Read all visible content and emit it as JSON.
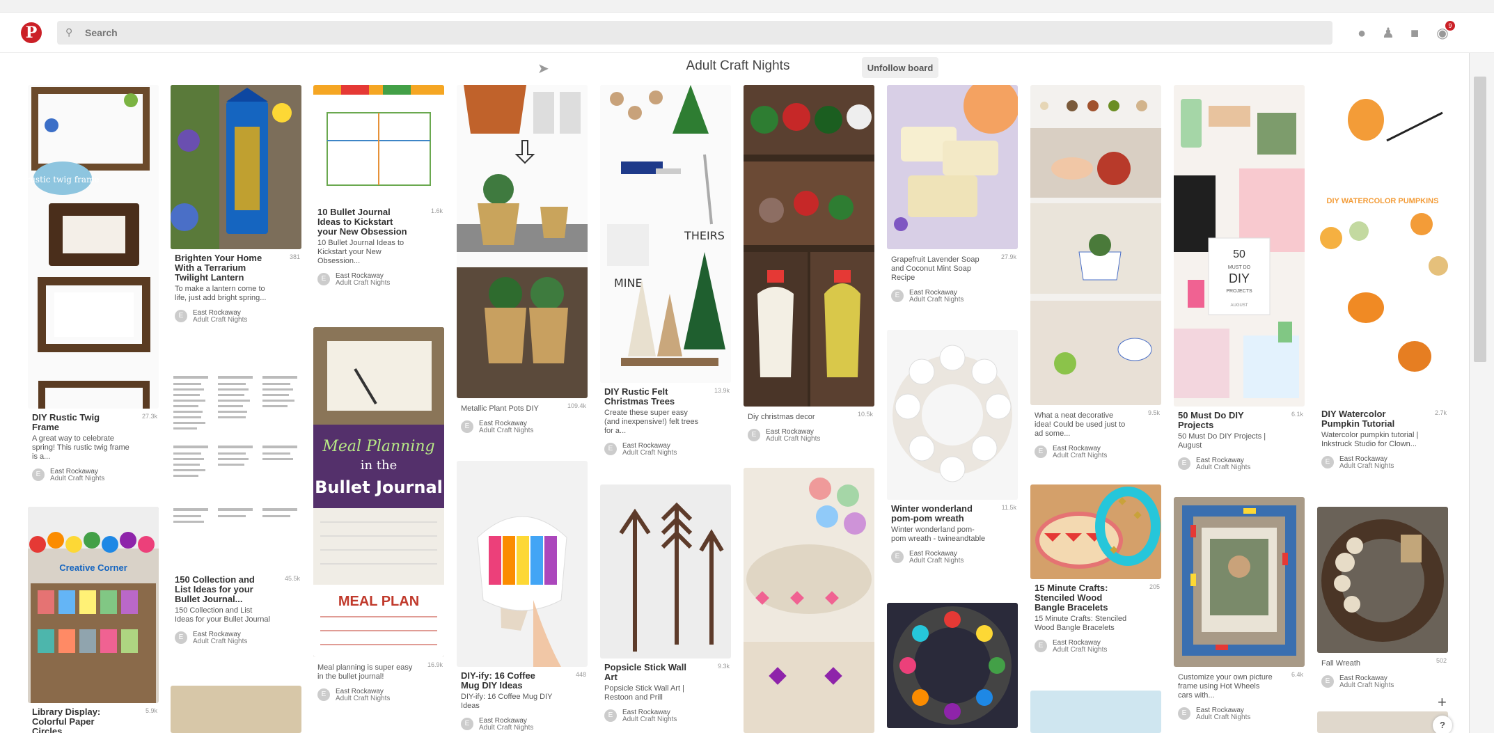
{
  "header": {
    "logo": "P",
    "search_placeholder": "Search",
    "notification_count": "9"
  },
  "board": {
    "title": "Adult Craft Nights",
    "unfollow_label": "Unfollow board"
  },
  "pins": [
    {
      "title": "DIY Rustic Twig Frame",
      "desc": "A great way to celebrate spring! This rustic twig frame is a...",
      "stat": "27.3k",
      "user": "East Rockaway",
      "board": "Adult Craft Nights"
    },
    {
      "title": "Library Display: Colorful Paper Circles",
      "desc": "",
      "stat": "5.9k",
      "user": "",
      "board": ""
    },
    {
      "title": "Brighten Your Home With a Terrarium Twilight Lantern",
      "desc": "To make a lantern come to life, just add bright spring...",
      "stat": "381",
      "user": "East Rockaway",
      "board": "Adult Craft Nights"
    },
    {
      "title": "150 Collection and List Ideas for your Bullet Journal...",
      "desc": "150 Collection and List Ideas for your Bullet Journal",
      "stat": "45.5k",
      "user": "East Rockaway",
      "board": "Adult Craft Nights"
    },
    {
      "title": "10 Bullet Journal Ideas to Kickstart your New Obsession",
      "desc": "10 Bullet Journal Ideas to Kickstart your New Obsession...",
      "stat": "1.6k",
      "user": "East Rockaway",
      "board": "Adult Craft Nights"
    },
    {
      "title": "",
      "desc": "Meal planning is super easy in the bullet journal!",
      "stat": "16.9k",
      "user": "East Rockaway",
      "board": "Adult Craft Nights"
    },
    {
      "title": "",
      "desc": "Metallic Plant Pots DIY",
      "stat": "109.4k",
      "user": "East Rockaway",
      "board": "Adult Craft Nights"
    },
    {
      "title": "DIY-ify: 16 Coffee Mug DIY Ideas",
      "desc": "DIY-ify: 16 Coffee Mug DIY Ideas",
      "stat": "448",
      "user": "East Rockaway",
      "board": "Adult Craft Nights"
    },
    {
      "title": "DIY Rustic Felt Christmas Trees",
      "desc": "Create these super easy (and inexpensive!) felt trees for a...",
      "stat": "13.9k",
      "user": "East Rockaway",
      "board": "Adult Craft Nights"
    },
    {
      "title": "Popsicle Stick Wall Art",
      "desc": "Popsicle Stick Wall Art | Restoon and Prill",
      "stat": "9.3k",
      "user": "East Rockaway",
      "board": "Adult Craft Nights"
    },
    {
      "title": "",
      "desc": "Diy christmas decor",
      "stat": "10.5k",
      "user": "East Rockaway",
      "board": "Adult Craft Nights"
    },
    {
      "title": "",
      "desc": "Grapefruit Lavender Soap and Coconut Mint Soap Recipe",
      "stat": "27.9k",
      "user": "East Rockaway",
      "board": "Adult Craft Nights"
    },
    {
      "title": "Winter wonderland pom-pom wreath",
      "desc": "Winter wonderland pom-pom wreath - twineandtable",
      "stat": "11.5k",
      "user": "East Rockaway",
      "board": "Adult Craft Nights"
    },
    {
      "title": "",
      "desc": "What a neat decorative idea! Could be used just to ad some...",
      "stat": "9.5k",
      "user": "East Rockaway",
      "board": "Adult Craft Nights"
    },
    {
      "title": "15 Minute Crafts: Stenciled Wood Bangle Bracelets",
      "desc": "15 Minute Crafts: Stenciled Wood Bangle Bracelets",
      "stat": "205",
      "user": "East Rockaway",
      "board": "Adult Craft Nights"
    },
    {
      "title": "50 Must Do DIY Projects",
      "desc": "50 Must Do DIY Projects | August",
      "stat": "6.1k",
      "user": "East Rockaway",
      "board": "Adult Craft Nights"
    },
    {
      "title": "",
      "desc": "Customize your own picture frame using Hot Wheels cars with...",
      "stat": "6.4k",
      "user": "East Rockaway",
      "board": "Adult Craft Nights"
    },
    {
      "title": "DIY Watercolor Pumpkin Tutorial",
      "desc": "Watercolor pumpkin tutorial | Inkstruck Studio for Clown...",
      "stat": "2.7k",
      "user": "East Rockaway",
      "board": "Adult Craft Nights"
    },
    {
      "title": "",
      "desc": "Fall Wreath",
      "stat": "502",
      "user": "East Rockaway",
      "board": "Adult Craft Nights"
    }
  ],
  "image_text": {
    "twig": "rustic twig frame",
    "theirs": "THEIRS",
    "mine": "MINE",
    "bj1": "Meal Planning",
    "bj2": "in the",
    "bj3": "Bullet Journal",
    "mealplan": "MEAL PLAN",
    "fifty": "50",
    "mustdo": "MUST DO",
    "diy": "DIY",
    "projects": "PROJECTS",
    "august": "AUGUST",
    "pumpkins": "DIY WATERCOLOR PUMPKINS",
    "libsign": "Creative Corner"
  },
  "footer": {
    "plus": "+",
    "help": "?"
  }
}
